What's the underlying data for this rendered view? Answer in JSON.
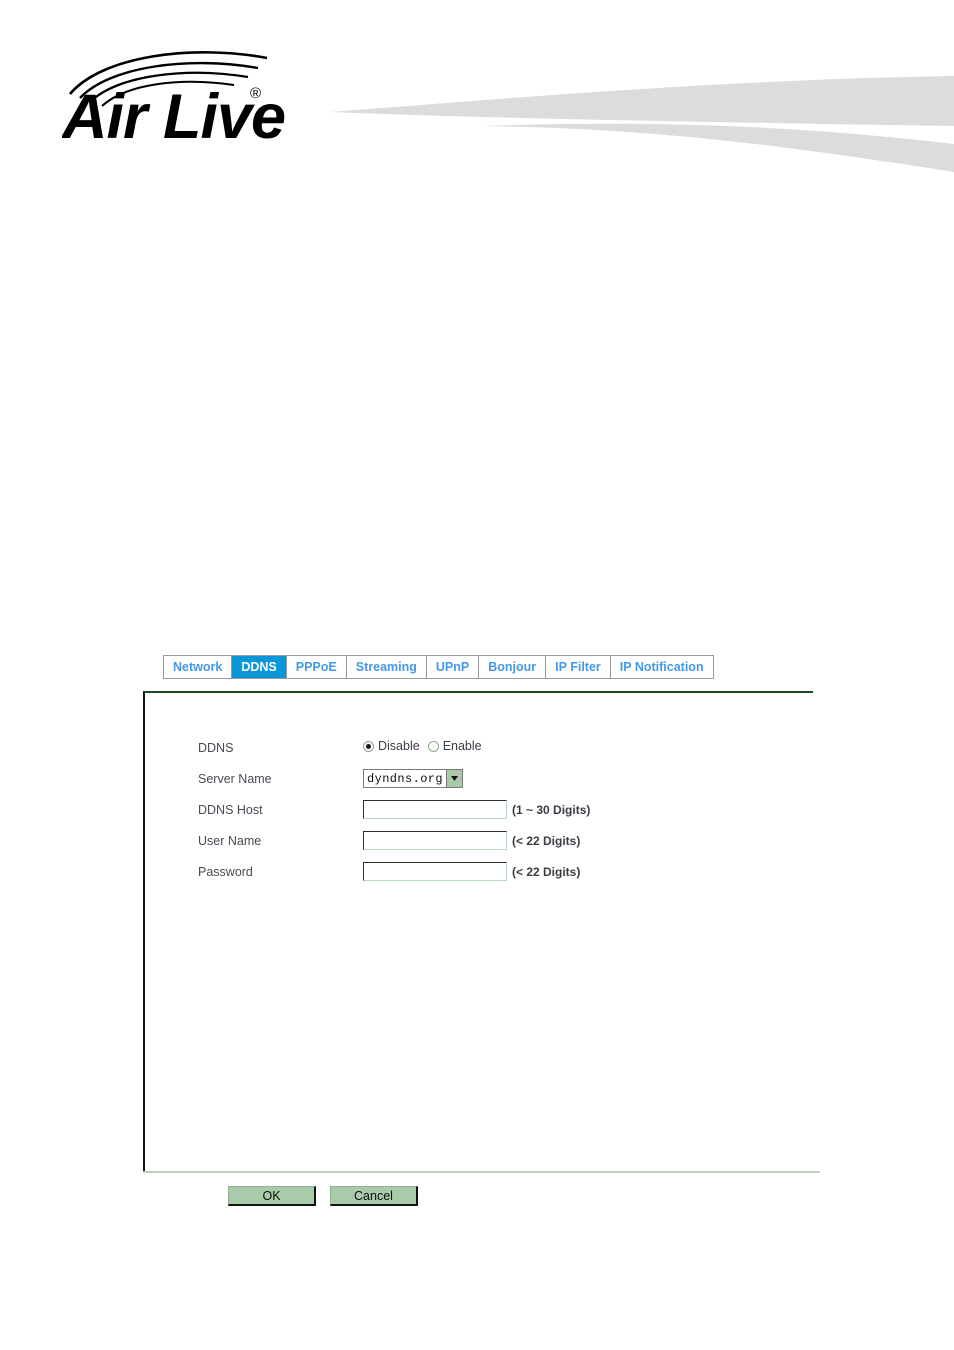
{
  "header": {
    "brand": "AirLive",
    "logo_text_air": "Air",
    "logo_text_live": "Live",
    "logo_registered_mark": "®",
    "swoosh_color": "#dcdcdc"
  },
  "tabs": {
    "items": [
      {
        "label": "Network",
        "active": false
      },
      {
        "label": "DDNS",
        "active": true
      },
      {
        "label": "PPPoE",
        "active": false
      },
      {
        "label": "Streaming",
        "active": false
      },
      {
        "label": "UPnP",
        "active": false
      },
      {
        "label": "Bonjour",
        "active": false
      },
      {
        "label": "IP Filter",
        "active": false
      },
      {
        "label": "IP Notification",
        "active": false
      }
    ],
    "active_bg": "#0b96d9",
    "inactive_color": "#4499e8"
  },
  "form": {
    "rows": {
      "ddns": {
        "label": "DDNS",
        "options": [
          {
            "label": "Disable",
            "selected": true
          },
          {
            "label": "Enable",
            "selected": false
          }
        ]
      },
      "server_name": {
        "label": "Server Name",
        "value": "dyndns.org"
      },
      "ddns_host": {
        "label": "DDNS Host",
        "value": "",
        "placeholder": "",
        "hint": "(1 ~ 30 Digits)"
      },
      "user_name": {
        "label": "User Name",
        "value": "",
        "placeholder": "",
        "hint": "(< 22 Digits)"
      },
      "password": {
        "label": "Password",
        "value": "",
        "placeholder": "",
        "hint": "(< 22 Digits)"
      }
    }
  },
  "buttons": {
    "ok": "OK",
    "cancel": "Cancel"
  }
}
